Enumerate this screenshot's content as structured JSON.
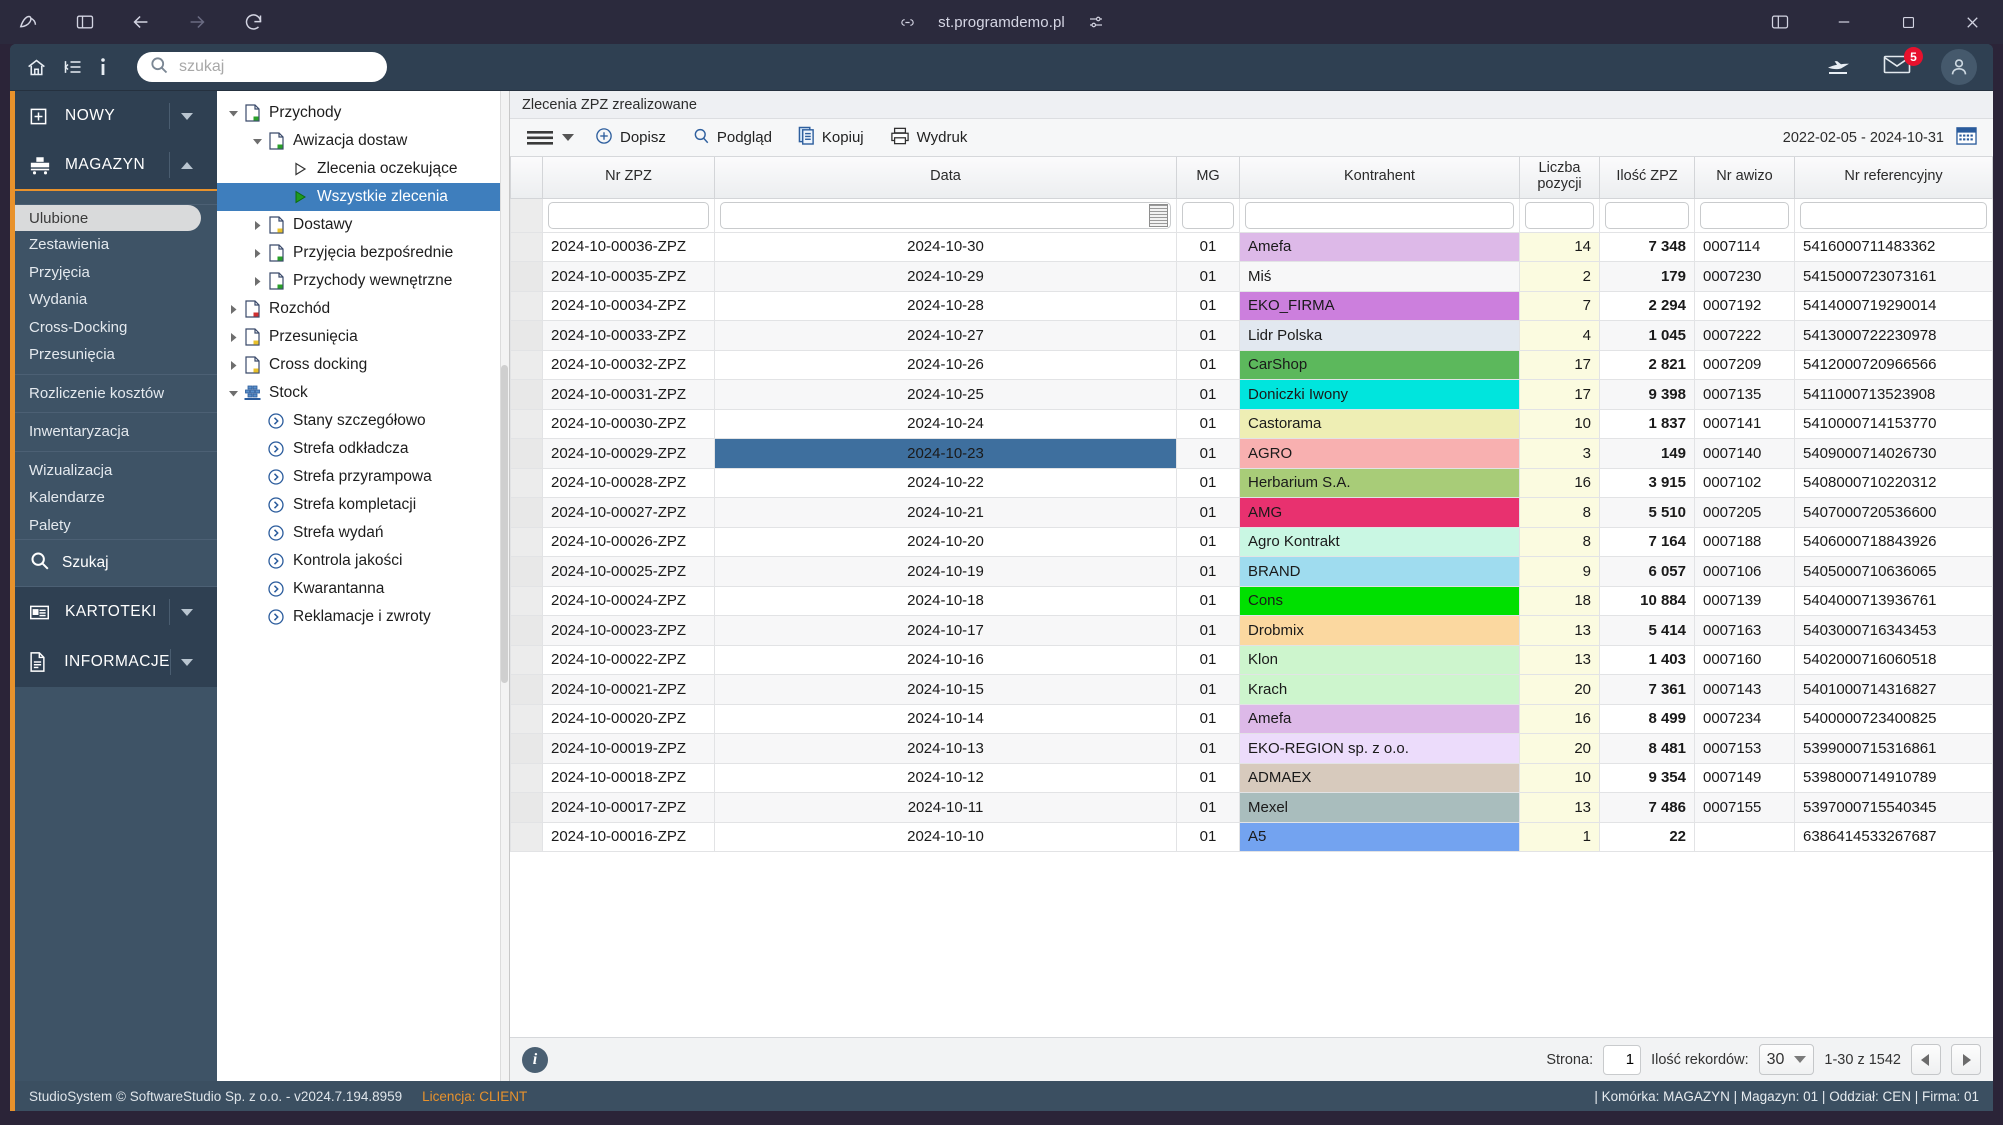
{
  "browser": {
    "url": "st.programdemo.pl",
    "icons": {
      "logo": "brand-logo-icon",
      "sidebar_toggle": "sidebar-toggle-icon",
      "back": "back-arrow-icon",
      "forward": "forward-arrow-icon",
      "reload": "reload-icon",
      "link": "link-icon",
      "settings": "sliders-icon",
      "split": "split-view-icon",
      "minimize": "minimize-icon",
      "maximize": "maximize-icon",
      "close": "close-icon"
    }
  },
  "app_header": {
    "home_icon": "home-icon",
    "menu_icon": "indent-list-icon",
    "info_icon": "info-icon",
    "search_placeholder": "szukaj",
    "search_value": "",
    "plane_icon": "send-plane-icon",
    "mail_icon": "mail-icon",
    "mail_badge": "5",
    "avatar_icon": "user-avatar-icon"
  },
  "sidebar": {
    "groups": [
      {
        "label": "NOWY",
        "icon": "plus-square-icon",
        "state": "collapsed"
      },
      {
        "label": "MAGAZYN",
        "icon": "warehouse-icon",
        "state": "expanded"
      }
    ],
    "items": [
      {
        "label": "Ulubione",
        "selected": true
      },
      {
        "label": "Zestawienia"
      },
      {
        "label": "Przyjęcia"
      },
      {
        "label": "Wydania"
      },
      {
        "label": "Cross-Docking"
      },
      {
        "label": "Przesunięcia"
      },
      {
        "label": "Rozliczenie kosztów",
        "sep_before": true
      },
      {
        "label": "Inwentaryzacja",
        "sep_before": true
      },
      {
        "label": "Wizualizacja",
        "sep_before": true
      },
      {
        "label": "Kalendarze"
      },
      {
        "label": "Palety"
      }
    ],
    "search_label": "Szukaj",
    "bottom_groups": [
      {
        "label": "KARTOTEKI",
        "icon": "cards-icon",
        "state": "collapsed"
      },
      {
        "label": "INFORMACJE",
        "icon": "document-icon",
        "state": "collapsed"
      }
    ]
  },
  "tree": [
    {
      "label": "Przychody",
      "depth": 0,
      "twisty": "down",
      "icon": "doc-green-icon"
    },
    {
      "label": "Awizacja dostaw",
      "depth": 1,
      "twisty": "down",
      "icon": "doc-green-icon"
    },
    {
      "label": "Zlecenia oczekujące",
      "depth": 2,
      "twisty": "none",
      "icon": "play-outline-icon"
    },
    {
      "label": "Wszystkie zlecenia",
      "depth": 2,
      "twisty": "none",
      "icon": "play-green-icon",
      "selected": true
    },
    {
      "label": "Dostawy",
      "depth": 1,
      "twisty": "right",
      "icon": "doc-yellow-icon"
    },
    {
      "label": "Przyjęcia bezpośrednie",
      "depth": 1,
      "twisty": "right",
      "icon": "doc-green-icon"
    },
    {
      "label": "Przychody wewnętrzne",
      "depth": 1,
      "twisty": "right",
      "icon": "doc-green-icon"
    },
    {
      "label": "Rozchód",
      "depth": 0,
      "twisty": "right",
      "icon": "doc-red-icon"
    },
    {
      "label": "Przesunięcia",
      "depth": 0,
      "twisty": "right",
      "icon": "doc-yellow-icon"
    },
    {
      "label": "Cross docking",
      "depth": 0,
      "twisty": "right",
      "icon": "doc-yellow-icon"
    },
    {
      "label": "Stock",
      "depth": 0,
      "twisty": "down",
      "icon": "stock-grid-icon"
    },
    {
      "label": "Stany szczegółowo",
      "depth": 1,
      "twisty": "none",
      "icon": "chevron-circle-icon"
    },
    {
      "label": "Strefa odkładcza",
      "depth": 1,
      "twisty": "none",
      "icon": "chevron-circle-icon"
    },
    {
      "label": "Strefa przyrampowa",
      "depth": 1,
      "twisty": "none",
      "icon": "chevron-circle-icon"
    },
    {
      "label": "Strefa kompletacji",
      "depth": 1,
      "twisty": "none",
      "icon": "chevron-circle-icon"
    },
    {
      "label": "Strefa wydań",
      "depth": 1,
      "twisty": "none",
      "icon": "chevron-circle-icon"
    },
    {
      "label": "Kontrola jakości",
      "depth": 1,
      "twisty": "none",
      "icon": "chevron-circle-icon"
    },
    {
      "label": "Kwarantanna",
      "depth": 1,
      "twisty": "none",
      "icon": "chevron-circle-icon"
    },
    {
      "label": "Reklamacje i zwroty",
      "depth": 1,
      "twisty": "none",
      "icon": "chevron-circle-icon"
    }
  ],
  "main": {
    "title": "Zlecenia ZPZ zrealizowane",
    "toolbar": {
      "menu_icon": "hamburger-icon",
      "buttons": [
        {
          "label": "Dopisz",
          "icon": "plus-circle-icon"
        },
        {
          "label": "Podgląd",
          "icon": "magnifier-icon"
        },
        {
          "label": "Kopiuj",
          "icon": "copy-icon"
        },
        {
          "label": "Wydruk",
          "icon": "printer-icon"
        }
      ],
      "date_range": "2022-02-05 - 2024-10-31",
      "calendar_icon": "calendar-icon"
    },
    "columns": [
      {
        "key": "nr_zpz",
        "label": "Nr ZPZ"
      },
      {
        "key": "data",
        "label": "Data"
      },
      {
        "key": "mg",
        "label": "MG"
      },
      {
        "key": "kontrahent",
        "label": "Kontrahent"
      },
      {
        "key": "liczba_pozycji",
        "label": "Liczba pozycji"
      },
      {
        "key": "ilosc_zpz",
        "label": "Ilość ZPZ"
      },
      {
        "key": "nr_awizo",
        "label": "Nr awizo"
      },
      {
        "key": "nr_referencyjny",
        "label": "Nr referencyjny"
      }
    ],
    "filters": {
      "nr_zpz": "",
      "data": "",
      "mg": "",
      "kontrahent": "",
      "liczba_pozycji": "",
      "ilosc_zpz": "",
      "nr_awizo": "",
      "nr_referencyjny": ""
    },
    "rows": [
      {
        "nr_zpz": "2024-10-00036-ZPZ",
        "data": "2024-10-30",
        "mg": "01",
        "kontrahent": "Amefa",
        "color": "#ddb9e8",
        "liczba_pozycji": "14",
        "ilosc_zpz": "7 348",
        "nr_awizo": "0007114",
        "nr_referencyjny": "5416000711483362"
      },
      {
        "nr_zpz": "2024-10-00035-ZPZ",
        "data": "2024-10-29",
        "mg": "01",
        "kontrahent": "Miś",
        "color": "",
        "liczba_pozycji": "2",
        "ilosc_zpz": "179",
        "nr_awizo": "0007230",
        "nr_referencyjny": "5415000723073161"
      },
      {
        "nr_zpz": "2024-10-00034-ZPZ",
        "data": "2024-10-28",
        "mg": "01",
        "kontrahent": "EKO_FIRMA",
        "color": "#cc7fdd",
        "liczba_pozycji": "7",
        "ilosc_zpz": "2 294",
        "nr_awizo": "0007192",
        "nr_referencyjny": "5414000719290014"
      },
      {
        "nr_zpz": "2024-10-00033-ZPZ",
        "data": "2024-10-27",
        "mg": "01",
        "kontrahent": "Lidr Polska",
        "color": "#e2e8f0",
        "liczba_pozycji": "4",
        "ilosc_zpz": "1 045",
        "nr_awizo": "0007222",
        "nr_referencyjny": "5413000722230978"
      },
      {
        "nr_zpz": "2024-10-00032-ZPZ",
        "data": "2024-10-26",
        "mg": "01",
        "kontrahent": "CarShop",
        "color": "#5cb85c",
        "liczba_pozycji": "17",
        "ilosc_zpz": "2 821",
        "nr_awizo": "0007209",
        "nr_referencyjny": "5412000720966566"
      },
      {
        "nr_zpz": "2024-10-00031-ZPZ",
        "data": "2024-10-25",
        "mg": "01",
        "kontrahent": "Doniczki Iwony",
        "color": "#00e5dd",
        "liczba_pozycji": "17",
        "ilosc_zpz": "9 398",
        "nr_awizo": "0007135",
        "nr_referencyjny": "5411000713523908"
      },
      {
        "nr_zpz": "2024-10-00030-ZPZ",
        "data": "2024-10-24",
        "mg": "01",
        "kontrahent": "Castorama",
        "color": "#eeeeb4",
        "liczba_pozycji": "10",
        "ilosc_zpz": "1 837",
        "nr_awizo": "0007141",
        "nr_referencyjny": "5410000714153770"
      },
      {
        "nr_zpz": "2024-10-00029-ZPZ",
        "data": "2024-10-23",
        "mg": "01",
        "kontrahent": "AGRO",
        "color": "#f8b0b0",
        "liczba_pozycji": "3",
        "ilosc_zpz": "149",
        "nr_awizo": "0007140",
        "nr_referencyjny": "5409000714026730",
        "date_selected": true
      },
      {
        "nr_zpz": "2024-10-00028-ZPZ",
        "data": "2024-10-22",
        "mg": "01",
        "kontrahent": "Herbarium S.A.",
        "color": "#a8cc78",
        "liczba_pozycji": "16",
        "ilosc_zpz": "3 915",
        "nr_awizo": "0007102",
        "nr_referencyjny": "5408000710220312"
      },
      {
        "nr_zpz": "2024-10-00027-ZPZ",
        "data": "2024-10-21",
        "mg": "01",
        "kontrahent": "AMG",
        "color": "#e8316f",
        "liczba_pozycji": "8",
        "ilosc_zpz": "5 510",
        "nr_awizo": "0007205",
        "nr_referencyjny": "5407000720536600"
      },
      {
        "nr_zpz": "2024-10-00026-ZPZ",
        "data": "2024-10-20",
        "mg": "01",
        "kontrahent": "Agro Kontrakt",
        "color": "#c9f7e3",
        "liczba_pozycji": "8",
        "ilosc_zpz": "7 164",
        "nr_awizo": "0007188",
        "nr_referencyjny": "5406000718843926"
      },
      {
        "nr_zpz": "2024-10-00025-ZPZ",
        "data": "2024-10-19",
        "mg": "01",
        "kontrahent": "BRAND",
        "color": "#9fdcef",
        "liczba_pozycji": "9",
        "ilosc_zpz": "6 057",
        "nr_awizo": "0007106",
        "nr_referencyjny": "5405000710636065"
      },
      {
        "nr_zpz": "2024-10-00024-ZPZ",
        "data": "2024-10-18",
        "mg": "01",
        "kontrahent": "Cons",
        "color": "#00e000",
        "liczba_pozycji": "18",
        "ilosc_zpz": "10 884",
        "nr_awizo": "0007139",
        "nr_referencyjny": "5404000713936761"
      },
      {
        "nr_zpz": "2024-10-00023-ZPZ",
        "data": "2024-10-17",
        "mg": "01",
        "kontrahent": "Drobmix",
        "color": "#fbd8a0",
        "liczba_pozycji": "13",
        "ilosc_zpz": "5 414",
        "nr_awizo": "0007163",
        "nr_referencyjny": "5403000716343453"
      },
      {
        "nr_zpz": "2024-10-00022-ZPZ",
        "data": "2024-10-16",
        "mg": "01",
        "kontrahent": "Klon",
        "color": "#cdf5cd",
        "liczba_pozycji": "13",
        "ilosc_zpz": "1 403",
        "nr_awizo": "0007160",
        "nr_referencyjny": "5402000716060518"
      },
      {
        "nr_zpz": "2024-10-00021-ZPZ",
        "data": "2024-10-15",
        "mg": "01",
        "kontrahent": "Krach",
        "color": "#cdf5cd",
        "liczba_pozycji": "20",
        "ilosc_zpz": "7 361",
        "nr_awizo": "0007143",
        "nr_referencyjny": "5401000714316827"
      },
      {
        "nr_zpz": "2024-10-00020-ZPZ",
        "data": "2024-10-14",
        "mg": "01",
        "kontrahent": "Amefa",
        "color": "#ddb9e8",
        "liczba_pozycji": "16",
        "ilosc_zpz": "8 499",
        "nr_awizo": "0007234",
        "nr_referencyjny": "5400000723400825"
      },
      {
        "nr_zpz": "2024-10-00019-ZPZ",
        "data": "2024-10-13",
        "mg": "01",
        "kontrahent": "EKO-REGION sp. z o.o.",
        "color": "#ecdcfb",
        "liczba_pozycji": "20",
        "ilosc_zpz": "8 481",
        "nr_awizo": "0007153",
        "nr_referencyjny": "5399000715316861"
      },
      {
        "nr_zpz": "2024-10-00018-ZPZ",
        "data": "2024-10-12",
        "mg": "01",
        "kontrahent": "ADMAEX",
        "color": "#d7cabd",
        "liczba_pozycji": "10",
        "ilosc_zpz": "9 354",
        "nr_awizo": "0007149",
        "nr_referencyjny": "5398000714910789"
      },
      {
        "nr_zpz": "2024-10-00017-ZPZ",
        "data": "2024-10-11",
        "mg": "01",
        "kontrahent": "Mexel",
        "color": "#a9bdbd",
        "liczba_pozycji": "13",
        "ilosc_zpz": "7 486",
        "nr_awizo": "0007155",
        "nr_referencyjny": "5397000715540345"
      },
      {
        "nr_zpz": "2024-10-00016-ZPZ",
        "data": "2024-10-10",
        "mg": "01",
        "kontrahent": "A5",
        "color": "#73a3f0",
        "liczba_pozycji": "1",
        "ilosc_zpz": "22",
        "nr_awizo": "",
        "nr_referencyjny": "6386414533267687"
      }
    ]
  },
  "pager": {
    "info_icon": "info-icon",
    "page_label": "Strona:",
    "page_value": "1",
    "records_label": "Ilość rekordów:",
    "page_size": "30",
    "range_text": "1-30 z 1542",
    "prev_icon": "prev-page-icon",
    "next_icon": "next-page-icon"
  },
  "status": {
    "left": "StudioSystem © SoftwareStudio Sp. z o.o. - v2024.7.194.8959",
    "license": "Licencja: CLIENT",
    "right": "| Komórka: MAGAZYN | Magazyn: 01 | Oddział: CEN | Firma: 01"
  }
}
